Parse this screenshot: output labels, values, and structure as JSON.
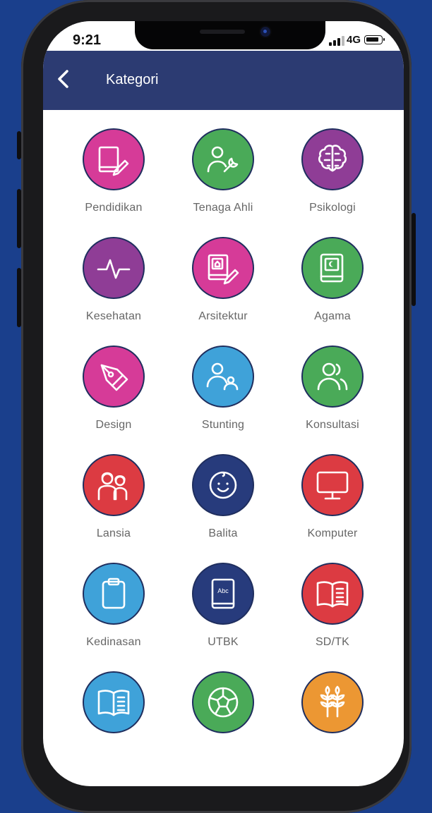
{
  "status_bar": {
    "time": "9:21",
    "network": "4G"
  },
  "app_bar": {
    "title": "Kategori"
  },
  "colors": {
    "background": "#1a3f8c",
    "app_bar": "#2c3b72",
    "magenta": "#d63b98",
    "green": "#4aaa58",
    "purple": "#8f3d96",
    "blue": "#3fa2d9",
    "red": "#dc3b42",
    "navy": "#273b7c",
    "orange": "#ec9733"
  },
  "categories": [
    {
      "label": "Pendidikan",
      "icon": "book-pencil-icon",
      "color": "#d63b98"
    },
    {
      "label": "Tenaga Ahli",
      "icon": "person-wrench-icon",
      "color": "#4aaa58"
    },
    {
      "label": "Psikologi",
      "icon": "brain-icon",
      "color": "#8f3d96"
    },
    {
      "label": "Kesehatan",
      "icon": "heartbeat-icon",
      "color": "#8f3d96"
    },
    {
      "label": "Arsitektur",
      "icon": "house-book-pencil-icon",
      "color": "#d63b98"
    },
    {
      "label": "Agama",
      "icon": "religious-book-icon",
      "color": "#4aaa58"
    },
    {
      "label": "Design",
      "icon": "pen-nib-icon",
      "color": "#d63b98"
    },
    {
      "label": "Stunting",
      "icon": "parent-child-icon",
      "color": "#3fa2d9"
    },
    {
      "label": "Konsultasi",
      "icon": "two-people-icon",
      "color": "#4aaa58"
    },
    {
      "label": "Lansia",
      "icon": "elderly-couple-icon",
      "color": "#dc3b42"
    },
    {
      "label": "Balita",
      "icon": "baby-face-icon",
      "color": "#273b7c"
    },
    {
      "label": "Komputer",
      "icon": "monitor-icon",
      "color": "#dc3b42"
    },
    {
      "label": "Kedinasan",
      "icon": "clipboard-icon",
      "color": "#3fa2d9"
    },
    {
      "label": "UTBK",
      "icon": "abc-book-icon",
      "color": "#273b7c"
    },
    {
      "label": "SD/TK",
      "icon": "open-book-icon",
      "color": "#dc3b42"
    },
    {
      "label": "",
      "icon": "open-book-icon",
      "color": "#3fa2d9"
    },
    {
      "label": "",
      "icon": "soccer-ball-icon",
      "color": "#4aaa58"
    },
    {
      "label": "",
      "icon": "wheat-icon",
      "color": "#ec9733"
    }
  ]
}
